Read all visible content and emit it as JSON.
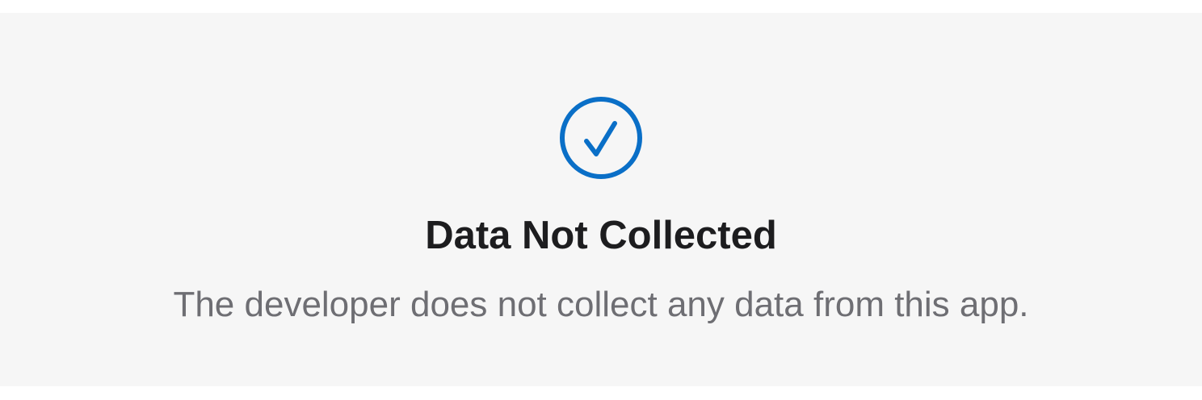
{
  "privacy_card": {
    "icon": "checkmark-circle-icon",
    "title": "Data Not Collected",
    "description": "The developer does not collect any data from this app."
  },
  "colors": {
    "accent": "#0a6fc7",
    "card_background": "#f6f6f6",
    "title_text": "#1d1d1f",
    "description_text": "#6e6e73"
  }
}
